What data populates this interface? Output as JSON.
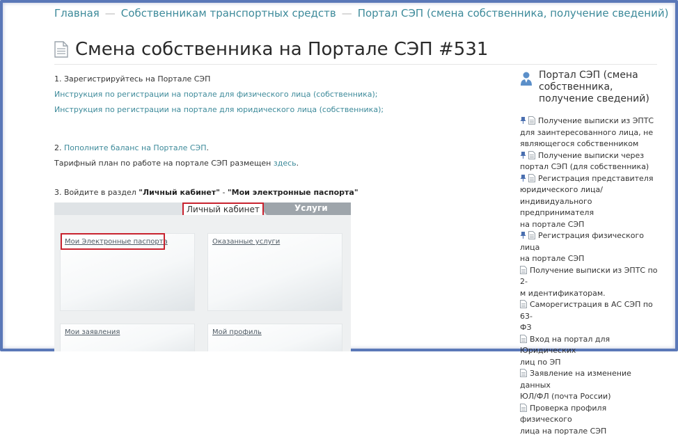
{
  "breadcrumb": {
    "home": "Главная",
    "section": "Собственникам транспортных средств",
    "current": "Портал СЭП (смена собственника, получение сведений)"
  },
  "page": {
    "title": "Смена собственника на Портале СЭП #531"
  },
  "content": {
    "step1_label": "1. Зарегистрируйтесь на Портале СЭП",
    "step1_link1": "Инструкция по регистрации на портале для физического лица (собственника);",
    "step1_link2": "Инструкция по регистрации на портале для юридического лица (собственника);",
    "step2_prefix": "2. ",
    "step2_link": "Пополните баланс на Портале СЭП",
    "step2_suffix": ".",
    "tariff_text": "Тарифный план по работе на портале СЭП размещен ",
    "tariff_link": "здесь",
    "tariff_suffix": ".",
    "step3_prefix": "3. Войдите в раздел ",
    "step3_bold1": "\"Личный кабинет\"",
    "step3_dash": " - ",
    "step3_bold2": "\"Мои электронные паспорта\""
  },
  "screenshot": {
    "tab_cabinet": "Личный кабинет",
    "tab_services": "Услуги",
    "card_passports": "Мои Электронные паспорта",
    "card_services": "Оказанные услуги",
    "card_applications": "Мои заявления",
    "card_profile": "Мой профиль"
  },
  "sidebar": {
    "title": "Портал СЭП (смена собственника, получение сведений)",
    "items": [
      {
        "pinned": true,
        "lines": [
          "Получение выписки из ЭПТС",
          "для заинтересованного лица, не",
          "являющегося собственником"
        ]
      },
      {
        "pinned": true,
        "lines": [
          "Получение выписки через",
          "портал СЭП (для собственника)"
        ]
      },
      {
        "pinned": true,
        "lines": [
          "Регистрация представителя",
          "юридического лица/",
          "индивидуального предпринимателя",
          "на портале СЭП"
        ]
      },
      {
        "pinned": true,
        "lines": [
          "Регистрация физического лица",
          "на портале СЭП"
        ]
      },
      {
        "pinned": false,
        "lines": [
          "Получение выписки из ЭПТС по 2-",
          "м идентификаторам."
        ]
      },
      {
        "pinned": false,
        "lines": [
          "Саморегистрация в АС СЭП по 63-",
          "ФЗ"
        ]
      },
      {
        "pinned": false,
        "lines": [
          "Вход на портал для Юридических",
          "лиц по ЭП"
        ]
      },
      {
        "pinned": false,
        "lines": [
          "Заявление на изменение данных",
          "ЮЛ/ФЛ (почта России)"
        ]
      },
      {
        "pinned": false,
        "lines": [
          "Проверка профиля физического",
          "лица на портале СЭП"
        ]
      }
    ]
  },
  "colors": {
    "link": "#3d8a9a",
    "frame": "#5a78b8",
    "highlight": "#c8222e",
    "pin": "#4a6fb0"
  }
}
